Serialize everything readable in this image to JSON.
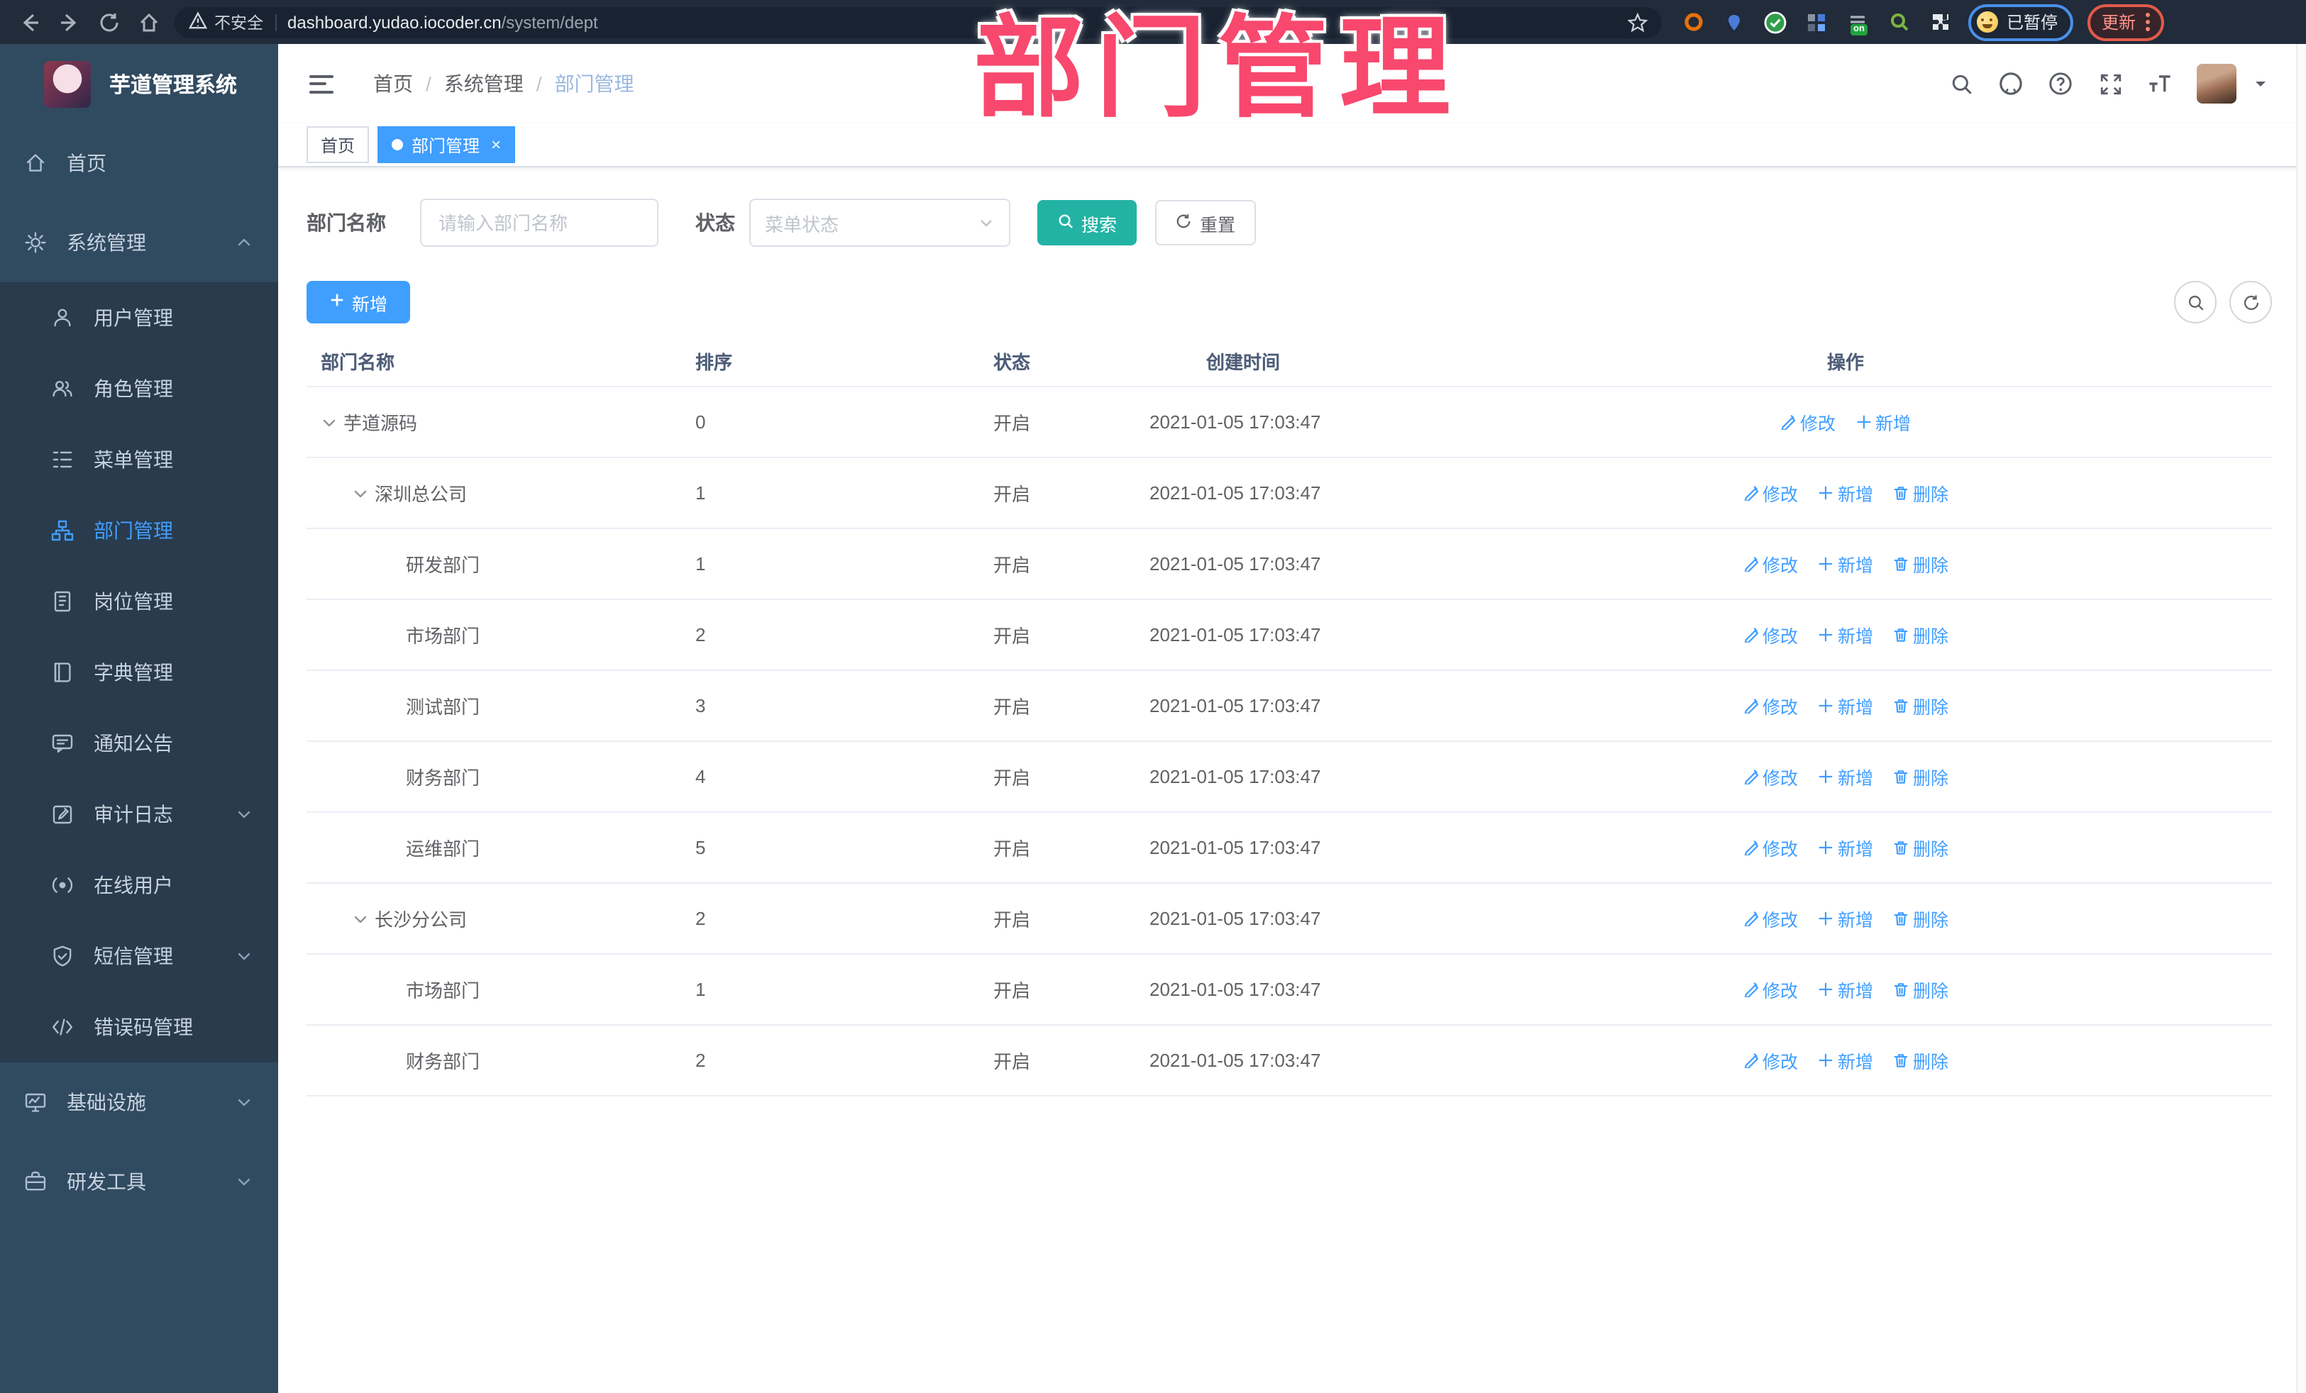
{
  "browser": {
    "security_label": "不安全",
    "url_host": "dashboard.yudao.iocoder.cn",
    "url_path": "/system/dept",
    "paused_label": "已暂停",
    "update_label": "更新",
    "extension_toggle_badge": "on"
  },
  "overlay": {
    "title": "部门管理"
  },
  "sidebar": {
    "app_title": "芋道管理系统",
    "items": [
      {
        "id": "home",
        "label": "首页",
        "icon": "home-icon",
        "kind": "root"
      },
      {
        "id": "system-management",
        "label": "系统管理",
        "icon": "gear-icon",
        "kind": "root",
        "chevron": "up",
        "expanded": true
      },
      {
        "id": "user-management",
        "label": "用户管理",
        "icon": "user-icon",
        "kind": "sub"
      },
      {
        "id": "role-management",
        "label": "角色管理",
        "icon": "role-icon",
        "kind": "sub"
      },
      {
        "id": "menu-management",
        "label": "菜单管理",
        "icon": "menu-tree-icon",
        "kind": "sub"
      },
      {
        "id": "dept-management",
        "label": "部门管理",
        "icon": "org-tree-icon",
        "kind": "sub",
        "active": true
      },
      {
        "id": "post-management",
        "label": "岗位管理",
        "icon": "badge-icon",
        "kind": "sub"
      },
      {
        "id": "dict-management",
        "label": "字典管理",
        "icon": "dict-icon",
        "kind": "sub"
      },
      {
        "id": "notice-announcement",
        "label": "通知公告",
        "icon": "announcement-icon",
        "kind": "sub"
      },
      {
        "id": "audit-log",
        "label": "审计日志",
        "icon": "audit-log-icon",
        "kind": "sub",
        "chevron": "down"
      },
      {
        "id": "online-users",
        "label": "在线用户",
        "icon": "online-user-icon",
        "kind": "sub"
      },
      {
        "id": "sms-management",
        "label": "短信管理",
        "icon": "sms-icon",
        "kind": "sub",
        "chevron": "down"
      },
      {
        "id": "error-code-management",
        "label": "错误码管理",
        "icon": "error-code-icon",
        "kind": "sub"
      },
      {
        "id": "infrastructure",
        "label": "基础设施",
        "icon": "infra-icon",
        "kind": "root",
        "chevron": "down"
      },
      {
        "id": "dev-tools",
        "label": "研发工具",
        "icon": "devtools-icon",
        "kind": "root",
        "chevron": "down"
      }
    ]
  },
  "header": {
    "breadcrumb": [
      "首页",
      "系统管理",
      "部门管理"
    ]
  },
  "tags": {
    "items": [
      {
        "label": "首页",
        "active": false
      },
      {
        "label": "部门管理",
        "active": true
      }
    ]
  },
  "search": {
    "name_label": "部门名称",
    "name_placeholder": "请输入部门名称",
    "status_label": "状态",
    "status_placeholder": "菜单状态",
    "search_label": "搜索",
    "reset_label": "重置"
  },
  "toolbar": {
    "add_label": "新增"
  },
  "table": {
    "columns": [
      "部门名称",
      "排序",
      "状态",
      "创建时间",
      "操作"
    ],
    "action_labels": {
      "edit": "修改",
      "add": "新增",
      "delete": "删除"
    },
    "rows": [
      {
        "name": "芋道源码",
        "level": 0,
        "expandable": true,
        "order": "0",
        "status": "开启",
        "created": "2021-01-05 17:03:47",
        "actions": [
          "edit",
          "add"
        ]
      },
      {
        "name": "深圳总公司",
        "level": 1,
        "expandable": true,
        "order": "1",
        "status": "开启",
        "created": "2021-01-05 17:03:47",
        "actions": [
          "edit",
          "add",
          "delete"
        ]
      },
      {
        "name": "研发部门",
        "level": 2,
        "expandable": false,
        "order": "1",
        "status": "开启",
        "created": "2021-01-05 17:03:47",
        "actions": [
          "edit",
          "add",
          "delete"
        ]
      },
      {
        "name": "市场部门",
        "level": 2,
        "expandable": false,
        "order": "2",
        "status": "开启",
        "created": "2021-01-05 17:03:47",
        "actions": [
          "edit",
          "add",
          "delete"
        ]
      },
      {
        "name": "测试部门",
        "level": 2,
        "expandable": false,
        "order": "3",
        "status": "开启",
        "created": "2021-01-05 17:03:47",
        "actions": [
          "edit",
          "add",
          "delete"
        ]
      },
      {
        "name": "财务部门",
        "level": 2,
        "expandable": false,
        "order": "4",
        "status": "开启",
        "created": "2021-01-05 17:03:47",
        "actions": [
          "edit",
          "add",
          "delete"
        ]
      },
      {
        "name": "运维部门",
        "level": 2,
        "expandable": false,
        "order": "5",
        "status": "开启",
        "created": "2021-01-05 17:03:47",
        "actions": [
          "edit",
          "add",
          "delete"
        ]
      },
      {
        "name": "长沙分公司",
        "level": 1,
        "expandable": true,
        "order": "2",
        "status": "开启",
        "created": "2021-01-05 17:03:47",
        "actions": [
          "edit",
          "add",
          "delete"
        ]
      },
      {
        "name": "市场部门",
        "level": 2,
        "expandable": false,
        "order": "1",
        "status": "开启",
        "created": "2021-01-05 17:03:47",
        "actions": [
          "edit",
          "add",
          "delete"
        ]
      },
      {
        "name": "财务部门",
        "level": 2,
        "expandable": false,
        "order": "2",
        "status": "开启",
        "created": "2021-01-05 17:03:47",
        "actions": [
          "edit",
          "add",
          "delete"
        ]
      }
    ]
  },
  "colors": {
    "primary": "#409eff",
    "search_teal": "#23b3a5",
    "sidebar_bg": "#304a60",
    "sidebar_sub_bg": "#293b4d",
    "annotation_pink": "#f8486d"
  }
}
